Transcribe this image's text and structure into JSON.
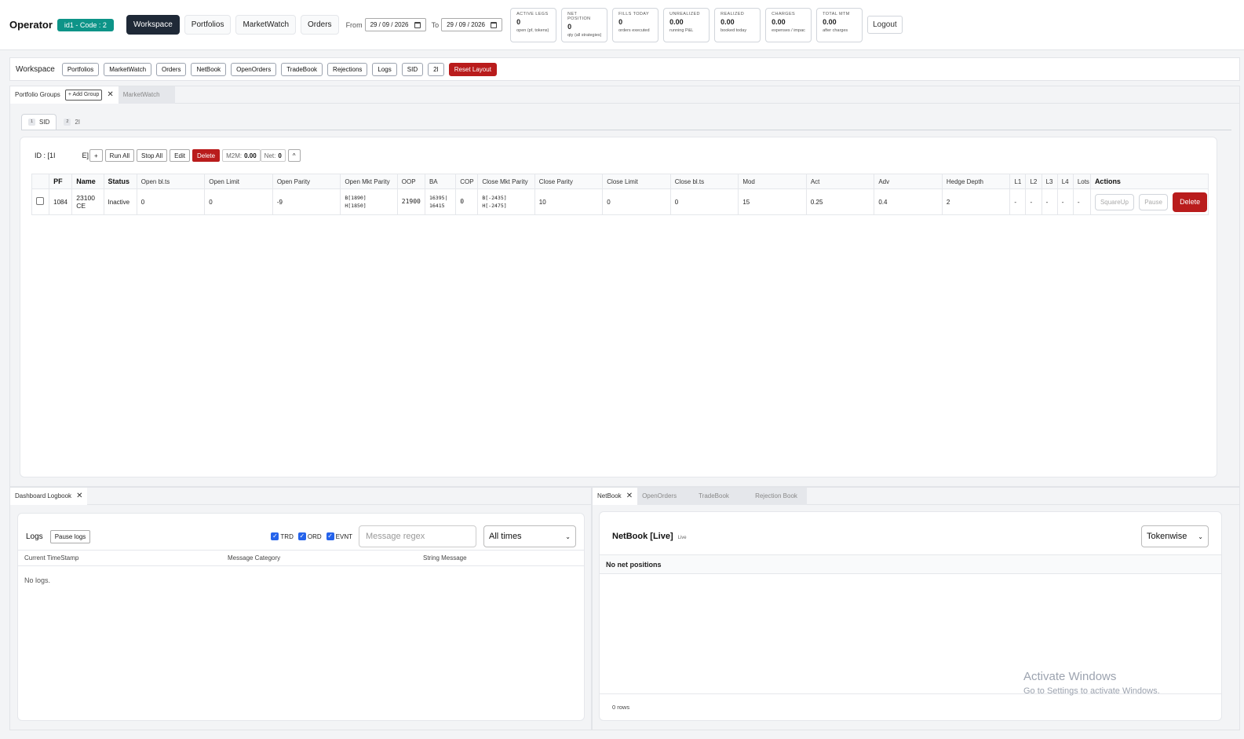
{
  "header": {
    "brand": "Operator",
    "code_badge": "id1 - Code : 2",
    "nav": [
      "Workspace",
      "Portfolios",
      "MarketWatch",
      "Orders"
    ],
    "from_label": "From",
    "from_date": "29 / 09 / 2026",
    "to_label": "To",
    "to_date": "29 / 09 / 2026",
    "stats": [
      {
        "title": "ACTIVE LEGS",
        "value": "0",
        "sub": "open (pf, tokens) pairs"
      },
      {
        "title": "NET POSITION",
        "value": "0",
        "sub": "qty (all strategies)"
      },
      {
        "title": "FILLS TODAY",
        "value": "0",
        "sub": "orders executed"
      },
      {
        "title": "UNREALIZED",
        "value": "0.00",
        "sub": "running P&L"
      },
      {
        "title": "REALIZED",
        "value": "0.00",
        "sub": "booked today"
      },
      {
        "title": "CHARGES",
        "value": "0.00",
        "sub": "expenses / impact"
      },
      {
        "title": "TOTAL MTM",
        "value": "0.00",
        "sub": "after charges"
      }
    ],
    "logout_label": "Logout"
  },
  "workspace_bar": {
    "title": "Workspace",
    "buttons": [
      "Portfolios",
      "MarketWatch",
      "Orders",
      "NetBook",
      "OpenOrders",
      "TradeBook",
      "Rejections",
      "Logs",
      "SID",
      "2I"
    ],
    "reset_label": "Reset Layout"
  },
  "portfolio_groups": {
    "tab_label": "Portfolio Groups",
    "add_group_label": "+ Add Group",
    "close_glyph": "✕",
    "inactive_tab": "MarketWatch",
    "subtabs": [
      {
        "num": "1",
        "label": "SID"
      },
      {
        "num": "2",
        "label": "2I"
      }
    ],
    "id_label": "ID : [1I",
    "id_suffix": "E]",
    "controls": {
      "add": "+",
      "run_all": "Run All",
      "stop_all": "Stop All",
      "edit": "Edit",
      "delete": "Delete",
      "m2m_label": "M2M:",
      "m2m_value": "0.00",
      "net_label": "Net:",
      "net_value": "0",
      "collapse": "^"
    },
    "columns": [
      "PF",
      "Name",
      "Status",
      "Open bl.ts",
      "Open Limit",
      "Open Parity",
      "Open Mkt Parity",
      "OOP",
      "BA",
      "COP",
      "Close Mkt Parity",
      "Close Parity",
      "Close Limit",
      "Close bl.ts",
      "Mod",
      "Act",
      "Adv",
      "Hedge Depth",
      "L1",
      "L2",
      "L3",
      "L4",
      "Lots",
      "Actions"
    ],
    "rows": [
      {
        "pf": "1084",
        "name": "23100 CE",
        "status": "Inactive",
        "open_blts": "0",
        "open_limit": "0",
        "open_parity": "-9",
        "open_mkt_parity_b": "B[1890]",
        "open_mkt_parity_h": "H[1850]",
        "oop": "21900",
        "ba_1": "16395|",
        "ba_2": "16415",
        "cop": "0",
        "close_mkt_parity_b": "B[-2435]",
        "close_mkt_parity_h": "H[-2475]",
        "close_parity": "10",
        "close_limit": "0",
        "close_blts": "0",
        "mod": "15",
        "act": "0.25",
        "adv": "0.4",
        "hedge_depth": "2",
        "l1": "-",
        "l2": "-",
        "l3": "-",
        "l4": "-",
        "lots": "-",
        "squareup": "SquareUp",
        "pause": "Pause",
        "delete": "Delete"
      }
    ]
  },
  "logbook": {
    "tab_label": "Dashboard Logbook",
    "close_glyph": "✕",
    "title": "Logs",
    "pause_label": "Pause logs",
    "filters": [
      "TRD",
      "ORD",
      "EVNT"
    ],
    "regex_placeholder": "Message regex",
    "time_select": "All times",
    "columns": [
      "Current TimeStamp",
      "Message Category",
      "String Message"
    ],
    "empty": "No logs."
  },
  "netbook": {
    "tabs": [
      "NetBook",
      "OpenOrders",
      "TradeBook",
      "Rejection Book"
    ],
    "close_glyph": "✕",
    "title": "NetBook [Live]",
    "live_badge": "Live",
    "mode_select": "Tokenwise",
    "empty": "No net positions",
    "footer": "0 rows"
  },
  "watermark": {
    "line1": "Activate Windows",
    "line2": "Go to Settings to activate Windows."
  }
}
